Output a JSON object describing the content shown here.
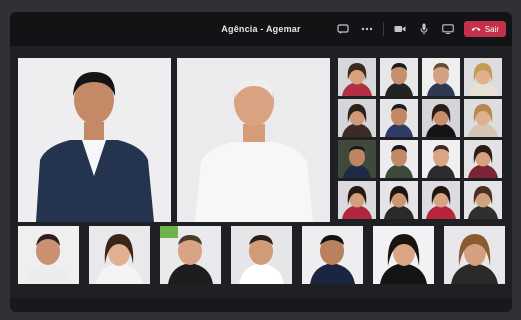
{
  "titlebar": {
    "title": "Agência - Agemar",
    "controls": [
      {
        "name": "chat-icon"
      },
      {
        "name": "more-options-icon"
      },
      {
        "name": "camera-icon"
      },
      {
        "name": "microphone-icon"
      },
      {
        "name": "share-screen-icon"
      }
    ],
    "leave_label": "Sair"
  },
  "colors": {
    "background": "#2f3136",
    "window": "#1f2023",
    "titlebar": "#121315",
    "leave_button": "#c4314b",
    "tile_light": "#e7e7ea"
  }
}
